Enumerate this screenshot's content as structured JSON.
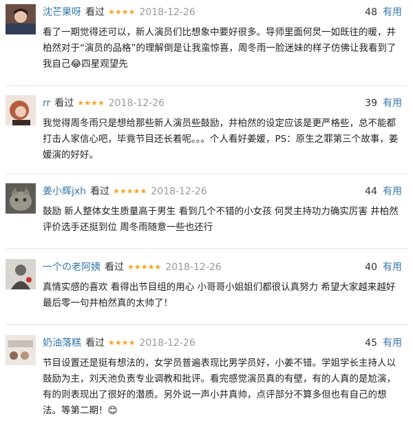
{
  "reviews": [
    {
      "user": "沈芒果呀",
      "action": "看过",
      "stars": "★★★★",
      "date": "2018-12-26",
      "votes": "48",
      "useful": "有用",
      "text": "看了一期觉得还可以，新人演员们比想象中要好很多。导师里面何炅一如既往的暖，井柏然对于“演员的品格”的理解倒是让我蛮惊喜，周冬雨一脸迷妹的样子仿佛让我看到了我自己😂四星观望先",
      "avatar_bg": "#8a6f66"
    },
    {
      "user": "rr",
      "action": "看过",
      "stars": "★★★★",
      "date": "2018-12-26",
      "votes": "39",
      "useful": "有用",
      "text": "我觉得周冬雨只是想给那些新人演员些鼓励，井柏然的设定应该是更严格些，总不能都打击人家信心吧，毕竟节目还长着呢。。。个人看好姜媛，PS：原生之罪第三个故事，姜媛演的好好。",
      "avatar_bg": "#c88b6a"
    },
    {
      "user": "姜小辉jxh",
      "action": "看过",
      "stars": "★★★★★",
      "date": "2018-12-26",
      "votes": "44",
      "useful": "有用",
      "text": "鼓励 新人整体女生质量高于男生 看到几个不错的小女孩 何炅主持功力确实厉害 井柏然评价选手还挺到位 周冬雨随意一些也还行",
      "avatar_bg": "#7a7a72"
    },
    {
      "user": "一个の老阿姨",
      "action": "看过",
      "stars": "★★★★★",
      "date": "2018-12-26",
      "votes": "40",
      "useful": "有用",
      "text": "真情实感的喜欢 看得出节目组的用心 小哥哥小姐姐们都很认真努力 希望大家越来越好 最后零一句井柏然真的太帅了！",
      "avatar_bg": "#a09a93"
    },
    {
      "user": "奶油落糕",
      "action": "看过",
      "stars": "★★★★",
      "date": "2018-12-26",
      "votes": "45",
      "useful": "有用",
      "text": "节目设置还是挺有想法的，女学员普遍表现比男学员好，小姜不错。学姐学长主持人以鼓励为主，刘天池负责专业调教和批评。看完感觉演员真的有壁，有的人真的是尬演，有的则表现出了很好的潜质。另外说一声小井真帅，点评部分不算多但也有自己的想法。等第二期！😊",
      "avatar_bg": "#d7cfc8"
    }
  ]
}
